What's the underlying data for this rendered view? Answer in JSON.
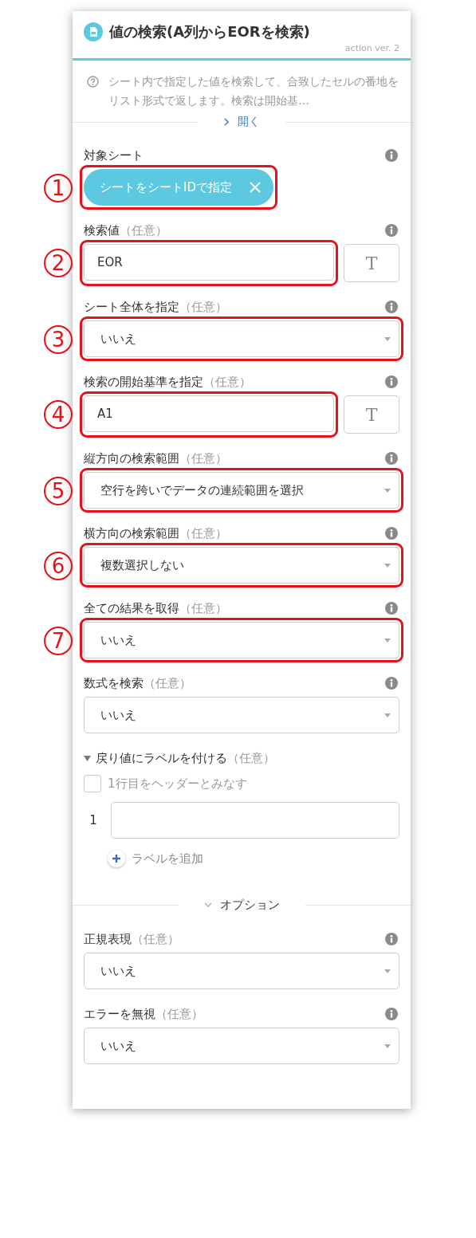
{
  "header": {
    "title": "値の検索(A列からEORを検索)",
    "version": "action ver. 2"
  },
  "description": {
    "text": "シート内で指定した値を検索して、合致したセルの番地をリスト形式で返します。検索は開始基…",
    "toggle": "開く",
    "expanded": false
  },
  "fields": [
    {
      "label": "対象シート",
      "kind": "chip",
      "value": "シートをシートIDで指定",
      "marker": "1",
      "highlighted": true
    },
    {
      "label": "検索値",
      "optional_note": "（任意）",
      "kind": "text",
      "value": "EOR",
      "type_button": "T",
      "marker": "2",
      "highlighted": true
    },
    {
      "label": "シート全体を指定",
      "optional_note": "（任意）",
      "kind": "select",
      "value": "いいえ",
      "marker": "3",
      "highlighted": true
    },
    {
      "label": "検索の開始基準を指定",
      "optional_note": "（任意）",
      "kind": "text",
      "value": "A1",
      "type_button": "T",
      "marker": "4",
      "highlighted": true
    },
    {
      "label": "縦方向の検索範囲",
      "optional_note": "（任意）",
      "kind": "select",
      "value": "空行を跨いでデータの連続範囲を選択",
      "marker": "5",
      "highlighted": true
    },
    {
      "label": "横方向の検索範囲",
      "optional_note": "（任意）",
      "kind": "select",
      "value": "複数選択しない",
      "marker": "6",
      "highlighted": true
    },
    {
      "label": "全ての結果を取得",
      "optional_note": "（任意）",
      "kind": "select",
      "value": "いいえ",
      "marker": "7",
      "highlighted": true
    },
    {
      "label": "数式を検索",
      "optional_note": "（任意）",
      "kind": "select",
      "value": "いいえ",
      "highlighted": false
    }
  ],
  "label_section": {
    "title": "戻り値にラベルを付ける",
    "optional_note": "（任意）",
    "expanded": true,
    "header_checkbox": {
      "label": "1行目をヘッダーとみなす",
      "checked": false
    },
    "rows": [
      {
        "index": "1"
      }
    ],
    "add_button": "ラベルを追加"
  },
  "options_divider": {
    "label": "オプション",
    "expanded": true
  },
  "option_fields": [
    {
      "label": "正規表現",
      "optional_note": "（任意）",
      "kind": "select",
      "value": "いいえ",
      "highlighted": false
    },
    {
      "label": "エラーを無視",
      "optional_note": "（任意）",
      "kind": "select",
      "value": "いいえ",
      "highlighted": false
    }
  ]
}
